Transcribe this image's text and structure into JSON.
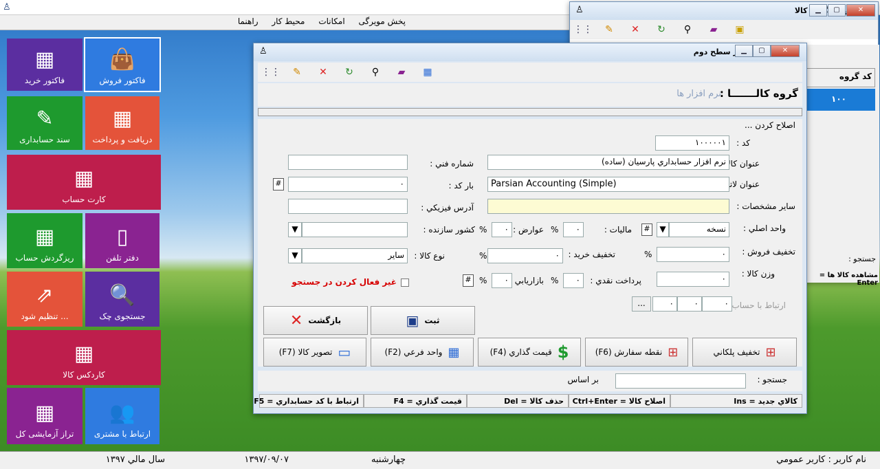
{
  "menu": [
    "راهنما",
    "محیط کار",
    "امکانات",
    "پخش مویرگی"
  ],
  "tiles": [
    {
      "id": "sales",
      "label": "فاکتور فروش",
      "icon": "👜",
      "color": "#2f7be0"
    },
    {
      "id": "purchase",
      "label": "فاکتور خرید",
      "icon": "▦",
      "color": "#5b2ea0"
    },
    {
      "id": "receive",
      "label": "دریافت و پرداخت",
      "icon": "▦",
      "color": "#e4533a"
    },
    {
      "id": "voucher",
      "label": "سند حسابداری",
      "icon": "✎",
      "color": "#1e9a2e"
    },
    {
      "id": "account-card",
      "label": "کارت حساب",
      "icon": "▦",
      "color": "#be1e4c"
    },
    {
      "id": "phonebook",
      "label": "دفتر تلفن",
      "icon": "▯",
      "color": "#8a2391"
    },
    {
      "id": "turnover",
      "label": "ریزگردش حساب",
      "icon": "▦",
      "color": "#1e9a2e"
    },
    {
      "id": "check-search",
      "label": "جستجوی چک",
      "icon": "🔍",
      "color": "#5b2ea0"
    },
    {
      "id": "settings",
      "label": "تنظیم شود ...",
      "icon": "⇗",
      "color": "#e4533a"
    },
    {
      "id": "kardex",
      "label": "کاردکس کالا",
      "icon": "▦",
      "color": "#be1e4c"
    },
    {
      "id": "customer",
      "label": "ارتباط با مشتری",
      "icon": "👥",
      "color": "#2f7be0"
    },
    {
      "id": "trial",
      "label": "تراز آزمایشی کل",
      "icon": "▦",
      "color": "#8a2391"
    }
  ],
  "back_window": {
    "title": "معرفي گروه کالا",
    "col_code": "کد گروه",
    "col_title": "عن",
    "row_code": "۱۰۰",
    "row_title": "نر",
    "search_label": "جستجو :",
    "footer": "مشاهده کالا ها = Enter"
  },
  "form": {
    "title": "معرفي کالا در سطح دوم",
    "group_label": "گروه کالـــــــا :",
    "group_value": "نرم افزار ها",
    "mode": "اصلاح کردن ...",
    "code_label": "کد :",
    "code_value": "۱۰۰۰۰۰۱",
    "name_label": "عنوان کالا :",
    "name_value": "نرم افزار حسابداري پارسيان (ساده)",
    "latin_label": "عنوان لاتين :",
    "latin_value": "Parsian Accounting (Simple)",
    "other_label": "ساير مشخصات :",
    "other_value": "",
    "tech_label": "شماره فني :",
    "tech_value": "",
    "barcode_label": "بار کد :",
    "barcode_value": "۰",
    "address_label": "آدرس فيزيکي :",
    "address_value": "",
    "unit_label": "واحد اصلي :",
    "unit_value": "نسخه",
    "tax_label": "ماليات :",
    "tax_value": "۰",
    "duty_label": "عوارض :",
    "duty_value": "۰",
    "country_label": "کشور سازنده :",
    "country_value": "",
    "sale_disc_label": "تخفيف فروش :",
    "sale_disc_value": "۰",
    "buy_disc_label": "تخفيف خريد :",
    "buy_disc_value": "۰",
    "type_label": "نوع کالا :",
    "type_value": "ساير",
    "weight_label": "وزن کالا :",
    "weight_value": "۰",
    "cash_label": "پرداخت نقدي :",
    "cash_value": "۰",
    "market_label": "بازاريابي :",
    "market_value": "۰",
    "percent": "%",
    "inactive_label": "غير فعال کردن در جستجو",
    "acc_label": "ارتباط با حساب :",
    "acc_values": [
      "۰",
      "۰",
      "۰"
    ],
    "acc_btn": "...",
    "save": "ثبت",
    "back": "بازگشت",
    "btn_tiered": "تخفيف پلکاني",
    "btn_reorder": "نقطه سفارش (F6)",
    "btn_price": "قيمت گذاري (F4)",
    "btn_subunit": "واحد فرعي (F2)",
    "btn_image": "تصوير کالا (F7)",
    "search_label": "جستجو :",
    "search_basis": "بر اساس",
    "status": [
      "کالاي جديد = Ins",
      "اصلاح کالا = Ctrl+Enter",
      "حذف کالا = Del",
      "قيمت گذاري = F4",
      "ارتباط با کد حسابداري = F5"
    ]
  },
  "statusbar": {
    "user": "نام کاربر : کاربر عمومي",
    "day": "چهارشنبه",
    "date": "۱۳۹۷/۰۹/۰۷",
    "fiscal": "سال مالي ۱۳۹۷"
  }
}
